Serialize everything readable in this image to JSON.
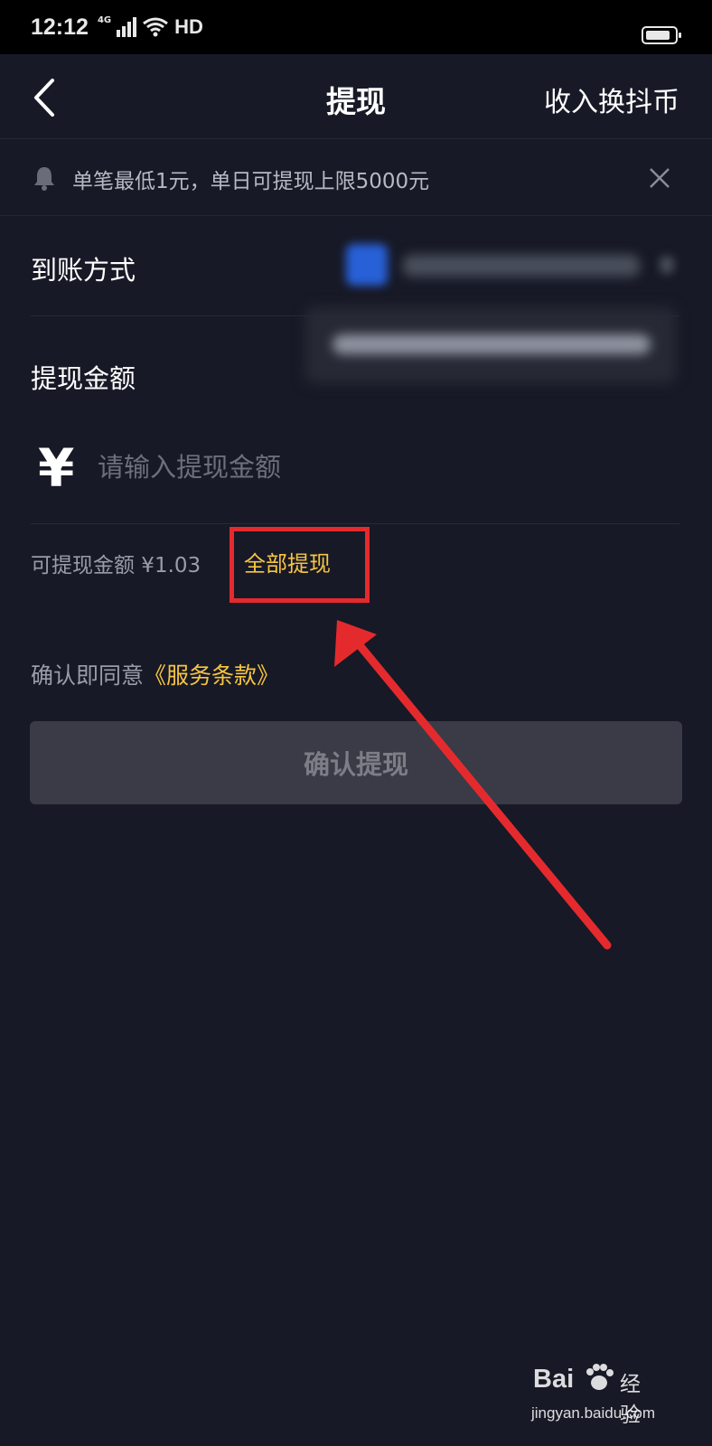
{
  "status_bar": {
    "time": "12:12",
    "network": "4G",
    "hd": "HD"
  },
  "nav": {
    "title": "提现",
    "right_action": "收入换抖币"
  },
  "notice": {
    "text": "单笔最低1元，单日可提现上限5000元"
  },
  "method": {
    "label": "到账方式"
  },
  "amount": {
    "label": "提现金额",
    "currency_symbol": "¥",
    "placeholder": "请输入提现金额",
    "value": ""
  },
  "available": {
    "text": "可提现金额 ¥1.03",
    "withdraw_all": "全部提现"
  },
  "agreement": {
    "prefix": "确认即同意",
    "link": "《服务条款》"
  },
  "confirm_button": {
    "label": "确认提现"
  },
  "watermark": {
    "logo_prefix": "Bai",
    "logo_cn": "经验",
    "url": "jingyan.baidu.com"
  },
  "colors": {
    "background": "#171926",
    "accent_gold": "#f7c543",
    "annotation_red": "#e52a2e",
    "button_disabled": "#3a3b46"
  },
  "icons": [
    "back-icon",
    "bell-icon",
    "close-icon",
    "wifi-icon",
    "signal-icon",
    "battery-icon",
    "yen-icon"
  ]
}
